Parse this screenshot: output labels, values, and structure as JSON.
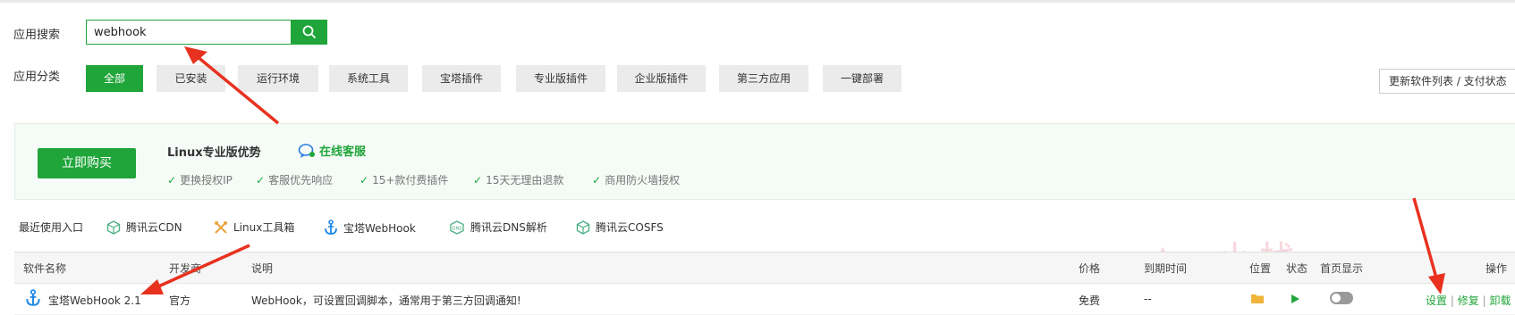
{
  "search": {
    "label": "应用搜索",
    "value": "webhook"
  },
  "category": {
    "label": "应用分类",
    "items": [
      "全部",
      "已安装",
      "运行环境",
      "系统工具",
      "宝塔插件",
      "专业版插件",
      "企业版插件",
      "第三方应用",
      "一键部署"
    ],
    "active": "全部"
  },
  "update_button": "更新软件列表 / 支付状态",
  "pro_banner": {
    "buy_button": "立即购买",
    "title": "Linux专业版优势",
    "service": "在线客服",
    "features": [
      "更换授权IP",
      "客服优先响应",
      "15+款付费插件",
      "15天无理由退款",
      "商用防火墙授权"
    ]
  },
  "recent": {
    "label": "最近使用入口",
    "items": [
      {
        "label": "腾讯云CDN",
        "icon": "tencent-cube-icon"
      },
      {
        "label": "Linux工具箱",
        "icon": "tools-icon"
      },
      {
        "label": "宝塔WebHook",
        "icon": "anchor-icon"
      },
      {
        "label": "腾讯云DNS解析",
        "icon": "dns-icon"
      },
      {
        "label": "腾讯云COSFS",
        "icon": "tencent-cube-icon"
      }
    ]
  },
  "table": {
    "headers": {
      "name": "软件名称",
      "developer": "开发商",
      "desc": "说明",
      "price": "价格",
      "expire": "到期时间",
      "location": "位置",
      "status": "状态",
      "homepage": "首页显示",
      "actions": "操作"
    },
    "rows": [
      {
        "name": "宝塔WebHook 2.1",
        "developer": "官方",
        "desc": "WebHook，可设置回调脚本，通常用于第三方回调通知!",
        "price": "免费",
        "expire": "--",
        "homepage_on": false,
        "actions": [
          "设置",
          "修复",
          "卸载"
        ]
      }
    ]
  },
  "watermark": "小栈",
  "colors": {
    "accent": "#20a53a",
    "annotation": "#e8321f"
  }
}
